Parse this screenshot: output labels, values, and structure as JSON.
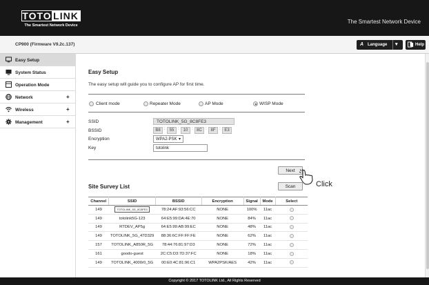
{
  "header": {
    "logo_word1": "TOTO",
    "logo_word2": "LINK",
    "logo_tagline": "The Smartest Network Device",
    "slogan": "The Smartest Network Device"
  },
  "subbar": {
    "firmware": "CP900 (Firmware V9.2c.137)",
    "language_label": "Language",
    "help_label": "Help"
  },
  "sidebar": {
    "items": [
      {
        "label": "Easy Setup",
        "icon": "monitor-icon",
        "active": true
      },
      {
        "label": "System Status",
        "icon": "status-icon"
      },
      {
        "label": "Operation Mode",
        "icon": "mode-icon"
      },
      {
        "label": "Network",
        "icon": "globe-icon",
        "arrow": "+"
      },
      {
        "label": "Wireless",
        "icon": "wifi-icon",
        "arrow": "+"
      },
      {
        "label": "Management",
        "icon": "gear-icon",
        "arrow": "+"
      }
    ]
  },
  "easy_setup": {
    "title": "Easy Setup",
    "description": "The easy setup will guide you to configure AP for first time.",
    "modes": [
      {
        "label": "Client mode",
        "selected": false
      },
      {
        "label": "Repeater Mode",
        "selected": false
      },
      {
        "label": "AP Mode",
        "selected": false
      },
      {
        "label": "WISP Mode",
        "selected": true
      }
    ],
    "ssid_label": "SSID",
    "ssid_value": "TOTOLINK_5G_8C8FE3",
    "bssid_label": "BSSID",
    "bssid_parts": [
      "B8",
      "55",
      "10",
      "8C",
      "8F",
      "E3"
    ],
    "encryption_label": "Encryption",
    "encryption_value": "WPA2-PSK",
    "key_label": "Key",
    "key_value": "totolink",
    "next_button": "Next",
    "scan_button": "Scan",
    "click_annotation": "Click"
  },
  "site_survey": {
    "title": "Site Survey List",
    "columns": [
      "Channel",
      "SSID",
      "BSSID",
      "Encryption",
      "Signal",
      "Mode",
      "Select"
    ],
    "rows": [
      {
        "channel": "149",
        "ssid": "TOTOLINK_5G_8C8FE3",
        "bssid": "78:24:AF:93:56:CC",
        "encryption": "NONE",
        "signal": "100%",
        "mode": "11ac",
        "highlight": true
      },
      {
        "channel": "149",
        "ssid": "totolink5G-123",
        "bssid": "64:E5:99:DA:4E:70",
        "encryption": "NONE",
        "signal": "84%",
        "mode": "11ac"
      },
      {
        "channel": "149",
        "ssid": "RTDEV_AP5g",
        "bssid": "64:E5:99:AB:99:EC",
        "encryption": "NONE",
        "signal": "48%",
        "mode": "11ac"
      },
      {
        "channel": "149",
        "ssid": "TOTOLINK_5G_47D329",
        "bssid": "88:36:6C:FF:FF:FE",
        "encryption": "NONE",
        "signal": "62%",
        "mode": "11ac"
      },
      {
        "channel": "157",
        "ssid": "TOTOLINK_A850R_5G",
        "bssid": "78:44:76:81:97:D3",
        "encryption": "NONE",
        "signal": "72%",
        "mode": "11ac"
      },
      {
        "channel": "161",
        "ssid": "goodo-guest",
        "bssid": "2C:C5:D3:7D:37:FC",
        "encryption": "NONE",
        "signal": "18%",
        "mode": "11ac"
      },
      {
        "channel": "149",
        "ssid": "TOTOLINK_4000r0_5G",
        "bssid": "00:E0:4C:81:96:C1",
        "encryption": "WPA2PSK/AES",
        "signal": "42%",
        "mode": "11ac"
      }
    ]
  },
  "footer": {
    "copyright": "Copyright © 2017 TOTOLINK Ltd., All Rights Reserved"
  }
}
